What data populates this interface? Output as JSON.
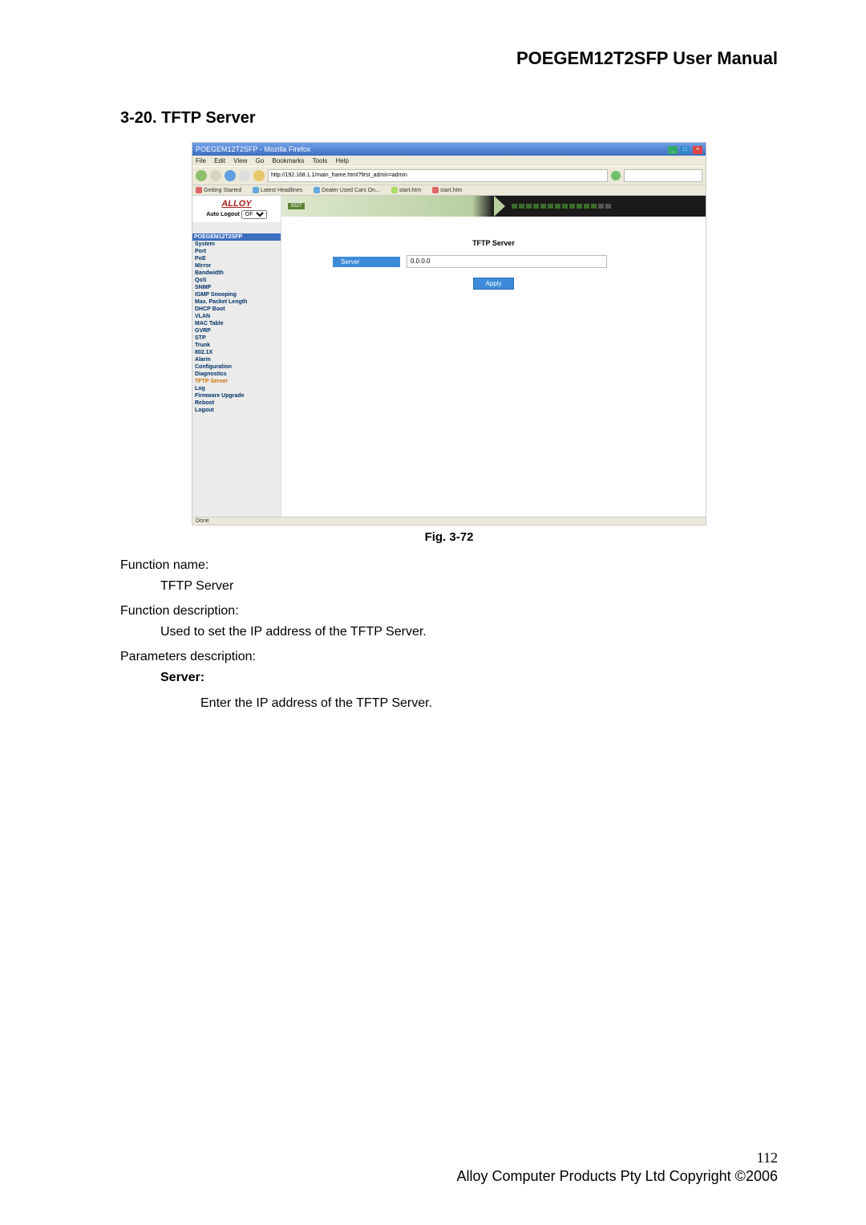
{
  "doc": {
    "title": "POEGEM12T2SFP User Manual",
    "section_heading": "3-20. TFTP Server",
    "fig_caption": "Fig. 3-72",
    "fn_name_label": "Function name:",
    "fn_name_value": "TFTP Server",
    "fn_desc_label": "Function description:",
    "fn_desc_value": "Used to set the IP address of the TFTP Server.",
    "params_label": "Parameters description:",
    "param_server_label": "Server:",
    "param_server_desc": "Enter the IP address of the TFTP Server.",
    "page_number": "112",
    "copyright": "Alloy Computer Products Pty Ltd Copyright ©2006"
  },
  "browser": {
    "window_title": "POEGEM12T2SFP - Mozilla Firefox",
    "menus": [
      "File",
      "Edit",
      "View",
      "Go",
      "Bookmarks",
      "Tools",
      "Help"
    ],
    "url": "http://192.168.1.1/main_frame.html?first_admin=admin",
    "go_label": "Go",
    "search_placeholder": "",
    "bookmarks": [
      "Getting Started",
      "Latest Headlines",
      "Dealer Used Cars On...",
      "start.htm",
      "start.htm"
    ],
    "status": "Done"
  },
  "app": {
    "logo": "ALLOY",
    "auto_logout_label": "Auto Logout",
    "auto_logout_value": "OFF",
    "device_header": "POEGEM12T2SFP",
    "hero_tag": "8327",
    "nav": [
      "System",
      "Port",
      "PoE",
      "Mirror",
      "Bandwidth",
      "QoS",
      "SNMP",
      "IGMP Snooping",
      "Max. Packet Length",
      "DHCP Boot",
      "VLAN",
      "MAC Table",
      "GVRP",
      "STP",
      "Trunk",
      "802.1X",
      "Alarm",
      "Configuration",
      "Diagnostics",
      "TFTP Server",
      "Log",
      "Firmware Upgrade",
      "Reboot",
      "Logout"
    ],
    "nav_active_index": 19,
    "panel_title": "TFTP Server",
    "server_label": "Server",
    "server_value": "0.0.0.0",
    "apply_label": "Apply"
  }
}
